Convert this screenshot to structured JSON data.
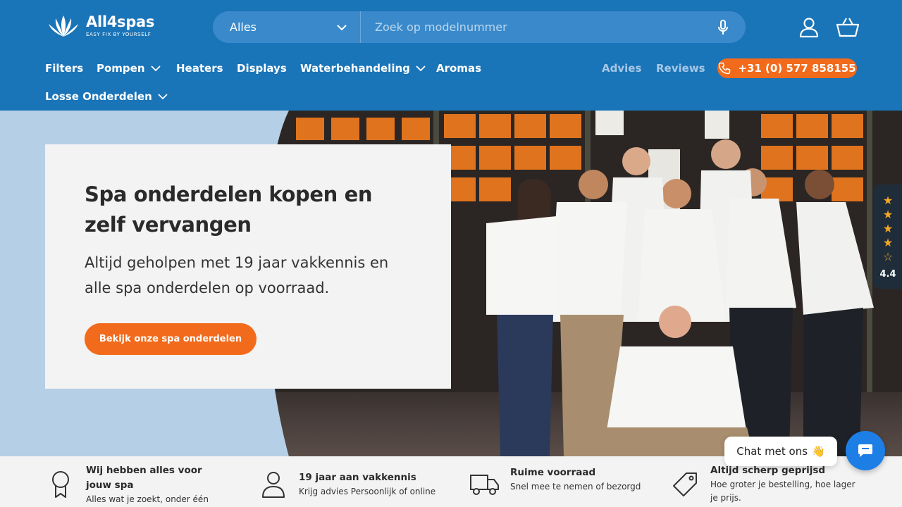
{
  "brand": {
    "name": "All4spas",
    "tagline": "EASY FIX BY YOURSELF",
    "primary_color": "#1a74b8",
    "accent_color": "#f26a1b"
  },
  "search": {
    "category": "Alles",
    "placeholder": "Zoek op modelnummer"
  },
  "header_icons": [
    "account-icon",
    "cart-icon"
  ],
  "nav": {
    "items": [
      {
        "label": "Filters",
        "dropdown": false
      },
      {
        "label": "Pompen",
        "dropdown": true
      },
      {
        "label": "Heaters",
        "dropdown": false
      },
      {
        "label": "Displays",
        "dropdown": false
      },
      {
        "label": "Waterbehandeling",
        "dropdown": true
      },
      {
        "label": "Aromas",
        "dropdown": false
      },
      {
        "label": "Losse Onderdelen",
        "dropdown": true
      }
    ],
    "secondary": [
      {
        "label": "Advies"
      },
      {
        "label": "Reviews"
      }
    ],
    "phone": "+31 (0) 577 858155"
  },
  "hero": {
    "title": "Spa onderdelen kopen en zelf vervangen",
    "subtitle": "Altijd geholpen met 19 jaar vakkennis en alle spa onderdelen op voorraad.",
    "cta": "Bekijk onze spa onderdelen"
  },
  "rating": {
    "score": "4.4",
    "stars": 4.4
  },
  "usps": [
    {
      "icon": "award-icon",
      "title": "Wij hebben alles voor jouw spa",
      "desc": "Alles wat je zoekt, onder één dak."
    },
    {
      "icon": "person-icon",
      "title": "19 jaar aan vakkennis",
      "desc": "Krijg advies Persoonlijk of online"
    },
    {
      "icon": "truck-icon",
      "title": "Ruime voorraad",
      "desc": "Snel mee te nemen of bezorgd"
    },
    {
      "icon": "price-tag-icon",
      "title": "Altijd scherp geprijsd",
      "desc": "Hoe groter je bestelling, hoe lager je prijs."
    }
  ],
  "chat": {
    "label": "Chat met ons",
    "emoji": "👋"
  }
}
